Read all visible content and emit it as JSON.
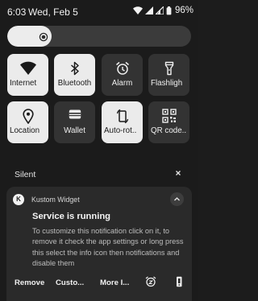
{
  "status_bar": {
    "time": "6:03",
    "date": "Wed, Feb 5",
    "battery": "96%",
    "icons": [
      "wifi-icon",
      "cellular-signal-icon",
      "cellular-signal-2-icon",
      "battery-icon"
    ]
  },
  "brightness": {
    "level": 0.24,
    "icon": "brightness-icon"
  },
  "tiles": [
    {
      "label": "Internet",
      "icon": "wifi-icon",
      "state": "on"
    },
    {
      "label": "Bluetooth",
      "icon": "bluetooth-icon",
      "state": "on"
    },
    {
      "label": "Alarm",
      "icon": "alarm-clock-icon",
      "state": "off"
    },
    {
      "label": "Flashligh",
      "icon": "flashlight-icon",
      "state": "off"
    },
    {
      "label": "Location",
      "icon": "location-pin-icon",
      "state": "on"
    },
    {
      "label": "Wallet",
      "icon": "wallet-icon",
      "state": "off"
    },
    {
      "label": "Auto-rot..",
      "icon": "auto-rotate-icon",
      "state": "on"
    },
    {
      "label": "QR code..",
      "icon": "qr-code-icon",
      "state": "off"
    }
  ],
  "silent_section": {
    "label": "Silent",
    "close_icon": "close-icon"
  },
  "notification": {
    "app_icon_letter": "K",
    "app_name": "Kustom Widget",
    "title": "Service is running",
    "body": "To customize this notification click on it, to remove it check the app settings or long press this select the info icon then notifications and disable them",
    "actions": [
      "Remove",
      "Custo...",
      "More I..."
    ],
    "action_icons": [
      "snooze-icon",
      "settings-icon"
    ]
  },
  "colors": {
    "background": "#1b1b1b",
    "tile_on": "#ebebeb",
    "tile_off": "#333333",
    "card": "#2a2a2a"
  }
}
